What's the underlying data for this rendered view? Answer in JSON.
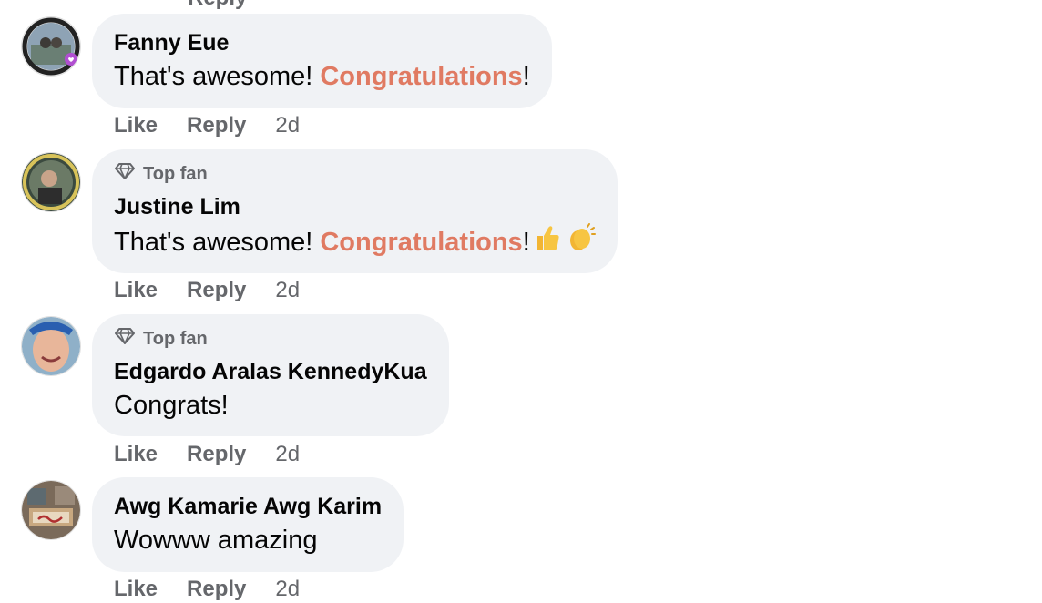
{
  "top_cut": {
    "reply_label": "Reply"
  },
  "comments": [
    {
      "author": "Fanny Eue",
      "badge": null,
      "text_before": "That's awesome! ",
      "highlight": "Congratulations",
      "text_after": "!",
      "emojis": [],
      "actions": {
        "like": "Like",
        "reply": "Reply",
        "time": "2d"
      }
    },
    {
      "author": "Justine Lim",
      "badge": "Top fan",
      "text_before": "That's awesome! ",
      "highlight": "Congratulations",
      "text_after": "!",
      "emojis": [
        "thumbs-up-emoji",
        "clapping-hands-emoji"
      ],
      "actions": {
        "like": "Like",
        "reply": "Reply",
        "time": "2d"
      }
    },
    {
      "author": "Edgardo Aralas KennedyKua",
      "badge": "Top fan",
      "text_before": "Congrats!",
      "highlight": "",
      "text_after": "",
      "emojis": [],
      "actions": {
        "like": "Like",
        "reply": "Reply",
        "time": "2d"
      }
    },
    {
      "author": "Awg Kamarie Awg Karim",
      "badge": null,
      "text_before": "Wowww amazing",
      "highlight": "",
      "text_after": "",
      "emojis": [],
      "actions": {
        "like": "Like",
        "reply": "Reply",
        "time": "2d"
      }
    }
  ],
  "colors": {
    "bubble_bg": "#f0f2f5",
    "highlight": "#e07a62",
    "muted": "#65676b",
    "text": "#050505"
  }
}
